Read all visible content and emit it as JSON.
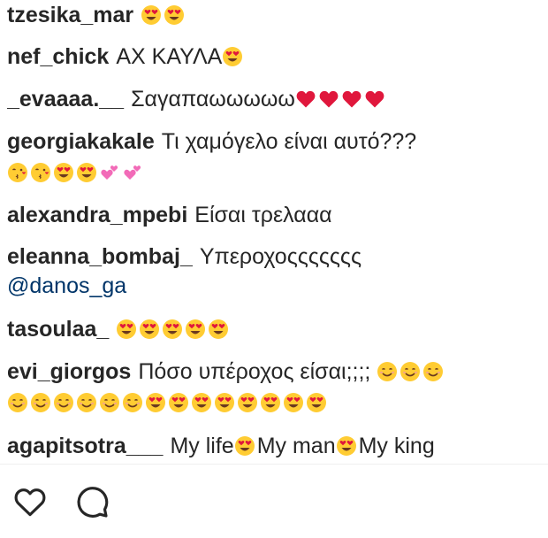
{
  "comments": [
    {
      "user": "tzesika_mar",
      "text": "",
      "emojis": [
        "heart-eyes",
        "heart-eyes"
      ]
    },
    {
      "user": "nef_chick",
      "text": "ΑΧ ΚΑΥΛΑ",
      "emojis": [
        "heart-eyes"
      ]
    },
    {
      "user": "_evaaaa.__",
      "text": "Σαγαπαωωωωω",
      "emojis": [
        "red-heart",
        "red-heart",
        "red-heart",
        "red-heart"
      ]
    },
    {
      "user": "georgiakakale",
      "text": "Τι χαμόγελο είναι αυτό???",
      "emojis2": [
        "kiss-face",
        "kiss-face",
        "heart-eyes",
        "heart-eyes",
        "two-hearts",
        "two-hearts"
      ]
    },
    {
      "user": "alexandra_mpebi",
      "text": "Είσαι τρελααα"
    },
    {
      "user": "eleanna_bombaj_",
      "text": "Υπεροχοςςςςςςς",
      "mention": "@danos_ga"
    },
    {
      "user": "tasoulaa_",
      "text": "",
      "emojis": [
        "heart-eyes",
        "heart-eyes",
        "heart-eyes",
        "heart-eyes",
        "heart-eyes"
      ]
    },
    {
      "user": "evi_giorgos",
      "text": "Πόσο υπέροχος είσαι;;;;",
      "emojis": [
        "smile",
        "smile",
        "smile"
      ],
      "emojis2": [
        "smile",
        "smile",
        "smile",
        "smile",
        "smile",
        "smile",
        "heart-eyes",
        "heart-eyes",
        "heart-eyes",
        "heart-eyes",
        "heart-eyes",
        "heart-eyes",
        "heart-eyes",
        "heart-eyes"
      ]
    },
    {
      "user": "agapitsotra___",
      "text": "",
      "parts": [
        {
          "text": "My life",
          "emoji": "heart-eyes"
        },
        {
          "text": "My man",
          "emoji": "heart-eyes"
        },
        {
          "text": "My king"
        }
      ]
    }
  ],
  "actions": {
    "like_icon": "heart-outline-icon",
    "comment_icon": "comment-outline-icon"
  },
  "colors": {
    "text": "#262626",
    "mention": "#003569",
    "emoji_face": "#FFCC33",
    "emoji_heart": "#E0173C",
    "emoji_pink": "#F26BB8"
  }
}
